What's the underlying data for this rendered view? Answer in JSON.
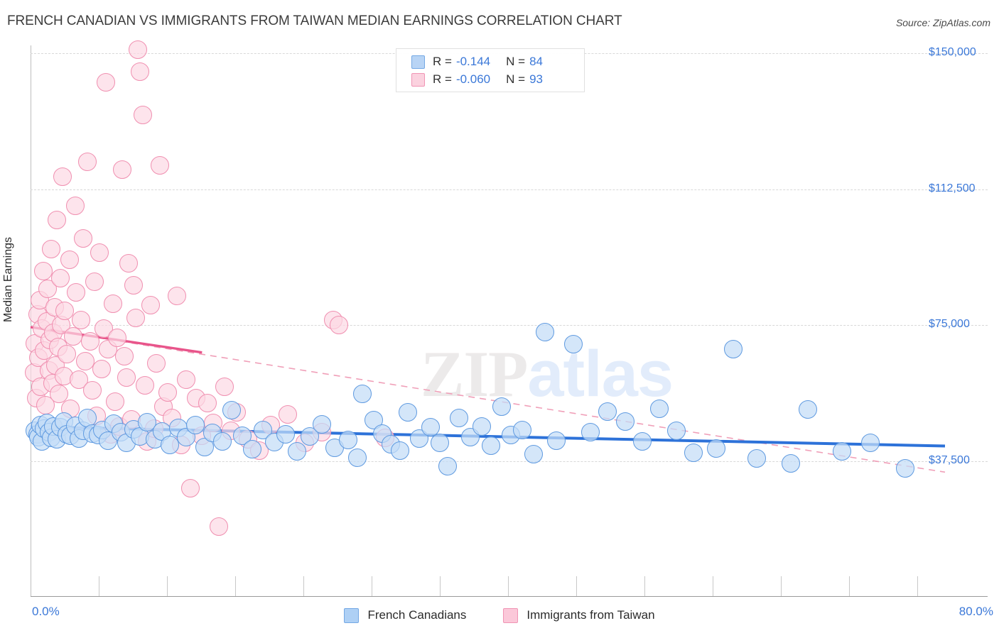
{
  "header": {
    "title": "FRENCH CANADIAN VS IMMIGRANTS FROM TAIWAN MEDIAN EARNINGS CORRELATION CHART",
    "source": "Source: ZipAtlas.com"
  },
  "watermark": {
    "part1": "ZIP",
    "part2": "atlas"
  },
  "stats_legend": {
    "rows": [
      {
        "series": "French Canadians",
        "r_label": "R =",
        "r_value": "-0.144",
        "n_label": "N =",
        "n_value": "84",
        "color": "#b8d4f5"
      },
      {
        "series": "Immigrants from Taiwan",
        "r_label": "R =",
        "r_value": "-0.060",
        "n_label": "N =",
        "n_value": "93",
        "color": "#fbd2df"
      }
    ]
  },
  "bottom_legend": {
    "items": [
      {
        "label": "French Canadians",
        "color": "#aed0f5"
      },
      {
        "label": "Immigrants from Taiwan",
        "color": "#fbc8d9"
      }
    ]
  },
  "axes": {
    "y_title": "Median Earnings",
    "y_ticks": [
      "$150,000",
      "$112,500",
      "$75,000",
      "$37,500"
    ],
    "x_min": "0.0%",
    "x_max": "80.0%"
  },
  "chart_data": {
    "type": "scatter",
    "title": "FRENCH CANADIAN VS IMMIGRANTS FROM TAIWAN MEDIAN EARNINGS CORRELATION CHART",
    "xlabel": "",
    "ylabel": "Median Earnings",
    "xlim": [
      0,
      80
    ],
    "ylim": [
      0,
      157000
    ],
    "x_unit": "percent",
    "y_unit": "usd",
    "grid": true,
    "gridlines_y": [
      150000,
      112500,
      75000,
      37500
    ],
    "legend_position": "bottom",
    "series": [
      {
        "name": "French Canadians",
        "color": "#aed0f5",
        "border_color": "#5f9ae0",
        "r": -0.144,
        "n": 84,
        "trendline": {
          "style": "solid",
          "x0": 0,
          "y0": 47000,
          "x1": 80,
          "y1": 41700
        },
        "points": [
          [
            0.4,
            46000
          ],
          [
            0.6,
            45000
          ],
          [
            0.7,
            44200
          ],
          [
            0.9,
            47500
          ],
          [
            1.0,
            43000
          ],
          [
            1.2,
            46500
          ],
          [
            1.4,
            48000
          ],
          [
            1.6,
            45500
          ],
          [
            1.8,
            44000
          ],
          [
            2.0,
            47000
          ],
          [
            2.3,
            43500
          ],
          [
            2.6,
            46800
          ],
          [
            2.9,
            48500
          ],
          [
            3.2,
            45000
          ],
          [
            3.5,
            44500
          ],
          [
            3.9,
            47200
          ],
          [
            4.2,
            43800
          ],
          [
            4.6,
            46000
          ],
          [
            5.0,
            49500
          ],
          [
            5.4,
            45200
          ],
          [
            5.9,
            44800
          ],
          [
            6.3,
            46200
          ],
          [
            6.8,
            43200
          ],
          [
            7.3,
            47800
          ],
          [
            7.9,
            45600
          ],
          [
            8.4,
            42500
          ],
          [
            9.0,
            46400
          ],
          [
            9.6,
            44300
          ],
          [
            10.2,
            48200
          ],
          [
            10.9,
            43600
          ],
          [
            11.5,
            45800
          ],
          [
            12.2,
            42000
          ],
          [
            12.9,
            46600
          ],
          [
            13.6,
            44100
          ],
          [
            14.4,
            47400
          ],
          [
            15.2,
            41500
          ],
          [
            15.9,
            45400
          ],
          [
            16.8,
            43000
          ],
          [
            17.6,
            51500
          ],
          [
            18.5,
            44600
          ],
          [
            19.4,
            40800
          ],
          [
            20.3,
            46100
          ],
          [
            21.3,
            42800
          ],
          [
            22.3,
            45000
          ],
          [
            23.3,
            40200
          ],
          [
            24.4,
            44400
          ],
          [
            25.5,
            47600
          ],
          [
            26.6,
            41200
          ],
          [
            27.8,
            43400
          ],
          [
            28.6,
            38500
          ],
          [
            29.0,
            56000
          ],
          [
            30.0,
            48800
          ],
          [
            30.8,
            45200
          ],
          [
            31.5,
            42200
          ],
          [
            32.3,
            40500
          ],
          [
            33.0,
            51000
          ],
          [
            34.0,
            43800
          ],
          [
            35.0,
            46800
          ],
          [
            35.8,
            42600
          ],
          [
            36.5,
            36200
          ],
          [
            37.5,
            49500
          ],
          [
            38.5,
            44200
          ],
          [
            39.5,
            47000
          ],
          [
            40.3,
            41800
          ],
          [
            41.2,
            52500
          ],
          [
            42.0,
            44800
          ],
          [
            43.0,
            46200
          ],
          [
            44.0,
            39500
          ],
          [
            45.0,
            73200
          ],
          [
            46.0,
            43200
          ],
          [
            47.5,
            69800
          ],
          [
            49.0,
            45600
          ],
          [
            50.5,
            51200
          ],
          [
            52.0,
            48500
          ],
          [
            53.5,
            43000
          ],
          [
            55.0,
            52000
          ],
          [
            56.5,
            46000
          ],
          [
            58.0,
            39800
          ],
          [
            60.0,
            41000
          ],
          [
            61.5,
            68500
          ],
          [
            63.5,
            38200
          ],
          [
            66.5,
            37000
          ],
          [
            68.0,
            51800
          ],
          [
            71.0,
            40200
          ],
          [
            73.5,
            42500
          ],
          [
            76.5,
            35500
          ]
        ]
      },
      {
        "name": "Immigrants from Taiwan",
        "color": "#fbc8d9",
        "border_color": "#f08fb0",
        "r": -0.06,
        "n": 93,
        "trendline": {
          "style": "solid-then-dashed",
          "x0": 0,
          "y0": 74500,
          "x1": 15,
          "y1": 67500,
          "x2": 80,
          "y2": 34500
        },
        "points": [
          [
            0.3,
            62000
          ],
          [
            0.4,
            70000
          ],
          [
            0.5,
            55000
          ],
          [
            0.6,
            78000
          ],
          [
            0.7,
            66000
          ],
          [
            0.8,
            82000
          ],
          [
            0.9,
            58000
          ],
          [
            1.0,
            74000
          ],
          [
            1.1,
            90000
          ],
          [
            1.2,
            68000
          ],
          [
            1.3,
            53000
          ],
          [
            1.4,
            76000
          ],
          [
            1.5,
            85000
          ],
          [
            1.6,
            62500
          ],
          [
            1.7,
            71000
          ],
          [
            1.8,
            96000
          ],
          [
            1.9,
            59000
          ],
          [
            2.0,
            73000
          ],
          [
            2.1,
            80000
          ],
          [
            2.2,
            64000
          ],
          [
            2.3,
            104000
          ],
          [
            2.4,
            69000
          ],
          [
            2.5,
            56000
          ],
          [
            2.6,
            88000
          ],
          [
            2.7,
            75000
          ],
          [
            2.8,
            116000
          ],
          [
            2.9,
            61000
          ],
          [
            3.0,
            79000
          ],
          [
            3.2,
            67000
          ],
          [
            3.4,
            93000
          ],
          [
            3.5,
            52000
          ],
          [
            3.7,
            72000
          ],
          [
            3.9,
            108000
          ],
          [
            4.0,
            84000
          ],
          [
            4.2,
            60000
          ],
          [
            4.4,
            76500
          ],
          [
            4.6,
            99000
          ],
          [
            4.8,
            65000
          ],
          [
            5.0,
            120000
          ],
          [
            5.2,
            70500
          ],
          [
            5.4,
            57000
          ],
          [
            5.6,
            87000
          ],
          [
            5.8,
            50000
          ],
          [
            6.0,
            95000
          ],
          [
            6.2,
            63000
          ],
          [
            6.4,
            74000
          ],
          [
            6.6,
            142000
          ],
          [
            6.8,
            68500
          ],
          [
            7.0,
            45000
          ],
          [
            7.2,
            81000
          ],
          [
            7.4,
            54000
          ],
          [
            7.6,
            71500
          ],
          [
            7.8,
            47000
          ],
          [
            8.0,
            118000
          ],
          [
            8.2,
            66500
          ],
          [
            8.4,
            60500
          ],
          [
            8.6,
            92000
          ],
          [
            8.8,
            49000
          ],
          [
            9.0,
            86000
          ],
          [
            9.2,
            77000
          ],
          [
            9.4,
            151000
          ],
          [
            9.6,
            145000
          ],
          [
            9.8,
            133000
          ],
          [
            10.0,
            58500
          ],
          [
            10.2,
            43000
          ],
          [
            10.5,
            80500
          ],
          [
            10.8,
            46500
          ],
          [
            11.0,
            64500
          ],
          [
            11.3,
            119000
          ],
          [
            11.6,
            52500
          ],
          [
            12.0,
            56500
          ],
          [
            12.4,
            49500
          ],
          [
            12.8,
            83000
          ],
          [
            13.2,
            42000
          ],
          [
            13.6,
            60000
          ],
          [
            14.0,
            30000
          ],
          [
            14.5,
            55000
          ],
          [
            15.0,
            44500
          ],
          [
            15.5,
            53500
          ],
          [
            16.0,
            48000
          ],
          [
            16.5,
            19500
          ],
          [
            17.0,
            58000
          ],
          [
            17.5,
            46000
          ],
          [
            18.0,
            51000
          ],
          [
            19.0,
            43500
          ],
          [
            20.0,
            40500
          ],
          [
            21.0,
            47500
          ],
          [
            22.5,
            50500
          ],
          [
            24.0,
            42500
          ],
          [
            25.5,
            45500
          ],
          [
            26.5,
            76500
          ],
          [
            27.0,
            75000
          ],
          [
            31.0,
            44000
          ]
        ]
      }
    ]
  }
}
